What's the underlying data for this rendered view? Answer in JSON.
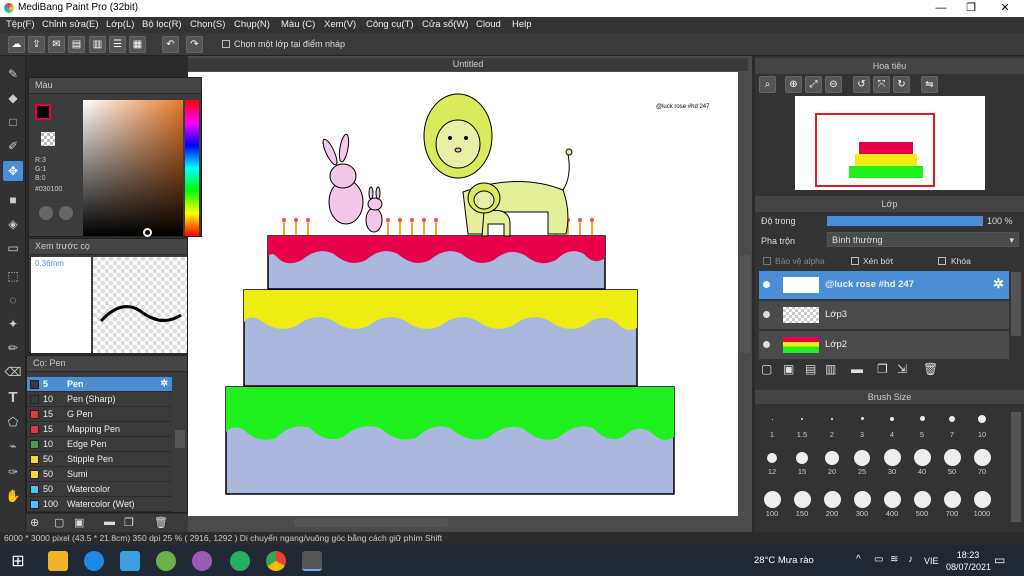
{
  "window": {
    "title": "MediBang Paint Pro (32bit)",
    "minimize": "—",
    "restore": "❐",
    "close": "✕"
  },
  "menu": [
    "Tệp(F)",
    "Chỉnh sửa(E)",
    "Lớp(L)",
    "Bộ lọc(R)",
    "Chọn(S)",
    "Chụp(N)",
    "Màu (C)",
    "Xem(V)",
    "Công cụ(T)",
    "Cửa sổ(W)",
    "Cloud",
    "Help"
  ],
  "toolbar": {
    "checkbox_label": "Chọn một lớp tại điểm nháp"
  },
  "document": {
    "tab_title": "Untitled",
    "watermark": "@luck rose #hd 247"
  },
  "color_panel": {
    "title": "Màu",
    "r": "R:3",
    "g": "G:1",
    "b": "B:0",
    "hex": "#030100",
    "accent": "#e8004a"
  },
  "preview_panel": {
    "title": "Xem trước cọ",
    "size": "0.36mm"
  },
  "brush_panel": {
    "title": "Cọ: Pen",
    "items": [
      {
        "size": "5",
        "name": "Pen",
        "color": "#3a3a3a"
      },
      {
        "size": "10",
        "name": "Pen (Sharp)",
        "color": "#3a3a3a"
      },
      {
        "size": "15",
        "name": "G Pen",
        "color": "#e53935"
      },
      {
        "size": "15",
        "name": "Mapping Pen",
        "color": "#e53935"
      },
      {
        "size": "10",
        "name": "Edge Pen",
        "color": "#43a047"
      },
      {
        "size": "50",
        "name": "Stipple Pen",
        "color": "#fdd835"
      },
      {
        "size": "50",
        "name": "Sumi",
        "color": "#fdd835"
      },
      {
        "size": "50",
        "name": "Watercolor",
        "color": "#4fc3f7"
      },
      {
        "size": "100",
        "name": "Watercolor (Wet)",
        "color": "#4fc3f7"
      }
    ]
  },
  "navigator": {
    "title": "Hoa tiêu"
  },
  "layer_panel": {
    "title": "Lớp",
    "opacity_label": "Độ trong",
    "opacity_value": "100 %",
    "blend_label": "Pha trộn",
    "blend_value": "Bình thường",
    "protect_alpha": "Bảo vệ alpha",
    "clipping": "Xén bớt",
    "lock": "Khóa",
    "layers": [
      {
        "name": "@luck rose #hd 247"
      },
      {
        "name": "Lớp3"
      },
      {
        "name": "Lớp2"
      }
    ]
  },
  "brush_size_panel": {
    "title": "Brush Size",
    "sizes": [
      "1",
      "1.5",
      "2",
      "3",
      "4",
      "5",
      "7",
      "10",
      "12",
      "15",
      "20",
      "25",
      "30",
      "40",
      "50",
      "70",
      "100",
      "150",
      "200",
      "300",
      "400",
      "500",
      "700",
      "1000"
    ]
  },
  "status": {
    "text": "6000 * 3000 pixel  (43.5 * 21.8cm)  350 dpi  25 %  ( 2916, 1292 )  Di chuyển ngang/vuông góc bằng cách giữ phím Shift"
  },
  "taskbar": {
    "weather": "28°C  Mưa rào",
    "lang": "VIE",
    "time": "18:23",
    "date": "08/07/2021"
  }
}
